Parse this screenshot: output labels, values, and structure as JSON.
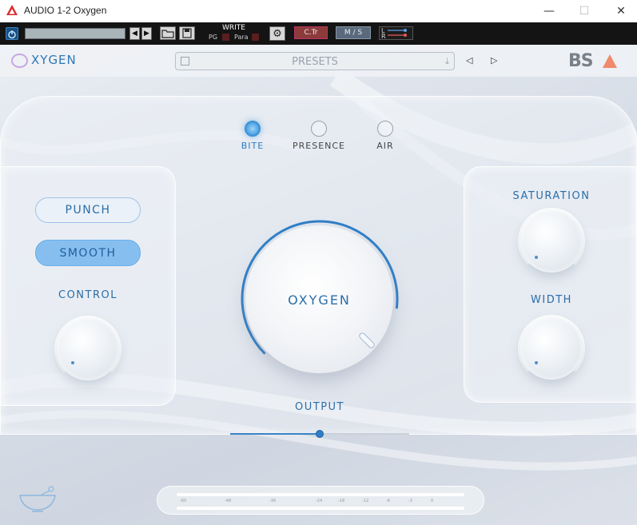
{
  "window": {
    "title": "AUDIO 1-2 Oxygen",
    "minimize_glyph": "—",
    "maximize_glyph": "☐",
    "close_glyph": "✕"
  },
  "toolbar": {
    "write_label": "WRITE",
    "pg_label": "PG",
    "para_label": "Para",
    "ctr_label": "C.Tr",
    "ms_label": "M / S",
    "l_label": "L",
    "r_label": "R",
    "prev_glyph": "◀",
    "next_glyph": "▶",
    "gear_glyph": "⚙"
  },
  "header": {
    "brand": "XYGEN",
    "presets_label": "PRESETS",
    "prev_glyph": "◁",
    "next_glyph": "▷",
    "company": "BS",
    "download_glyph": "⤓"
  },
  "modes": [
    {
      "label": "BITE",
      "active": true
    },
    {
      "label": "PRESENCE",
      "active": false
    },
    {
      "label": "AIR",
      "active": false
    }
  ],
  "left": {
    "punch_label": "PUNCH",
    "smooth_label": "SMOOTH",
    "control_label": "CONTROL",
    "control_value": 0.05
  },
  "center": {
    "knob_label": "OXYGEN",
    "oxygen_value": 0.86,
    "output_label": "OUTPUT",
    "output_value": 0.5
  },
  "right": {
    "saturation_label": "SATURATION",
    "saturation_value": 0.05,
    "width_label": "WIDTH",
    "width_value": 0.05
  },
  "meter": {
    "scale": [
      "-60",
      "-48",
      "-36",
      "-24",
      "-18",
      "-12",
      "-6",
      "-3",
      "0"
    ]
  },
  "colors": {
    "accent": "#2f7fc8",
    "smooth_active": "#86bfef",
    "bs_triangle": "#f08a6a"
  }
}
